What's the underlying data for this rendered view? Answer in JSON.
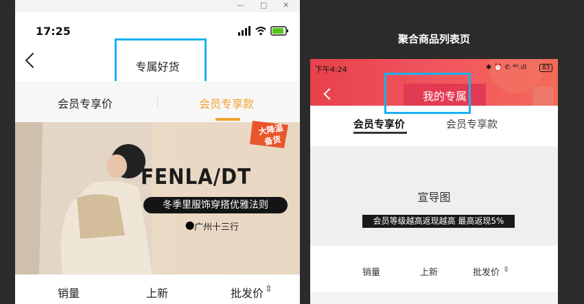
{
  "left_phone": {
    "window_controls": [
      "—",
      "□",
      "✕"
    ],
    "status_time": "17:25",
    "nav_title": "专属好货",
    "tabs": [
      {
        "label": "会员专享价",
        "active": false
      },
      {
        "label": "会员专享款",
        "active": true
      }
    ],
    "banner": {
      "corner_badge": "大降温\n备货",
      "brand": "FENLA/DT",
      "slogan": "冬季里服饰穿搭优雅法则",
      "location": "广州十三行"
    },
    "sort_options": [
      "销量",
      "上新",
      "批发价"
    ],
    "sort_icon": "⇳"
  },
  "right_phone": {
    "section_title": "聚合商品列表页",
    "status_time": "下午4:24",
    "status_icons": "✱ ⏰ ✆ ⁴ᴳ.ıll",
    "battery": "83",
    "nav_title": "我的专属",
    "tabs": [
      {
        "label": "会员专享价",
        "active": true
      },
      {
        "label": "会员专享款",
        "active": false
      }
    ],
    "promo": {
      "label": "宣导图",
      "bar_text": "会员等级越高返现越高   最高返现5%"
    },
    "sort_options": [
      "销量",
      "上新",
      "批发价"
    ],
    "sort_icon": "⇳"
  },
  "colors": {
    "accent_orange": "#f0a22d",
    "highlight_blue": "#1ab1f0",
    "header_red": "#e8414c"
  }
}
